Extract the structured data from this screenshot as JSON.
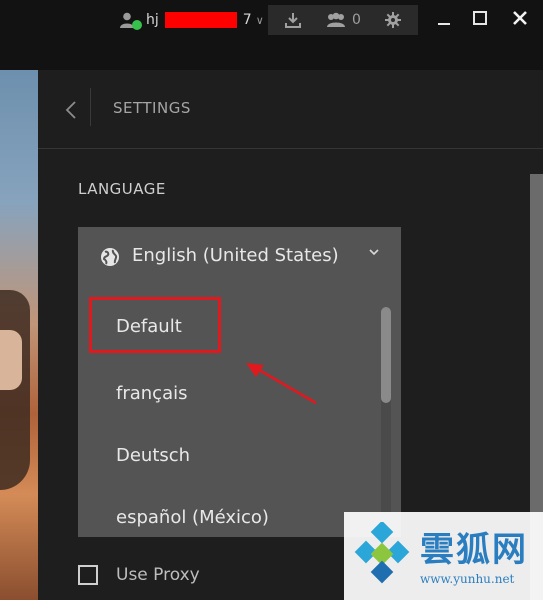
{
  "titlebar": {
    "username_prefix": "hj",
    "username_suffix": "7",
    "friends_count": "0"
  },
  "settings": {
    "header_title": "SETTINGS",
    "language_label": "LANGUAGE",
    "selected_language": "English (United States)",
    "options": [
      "Default",
      "français",
      "Deutsch",
      "español (México)"
    ],
    "use_proxy_label": "Use Proxy"
  },
  "watermark": {
    "cn_text": "雲狐网",
    "url": "www.yunhu.net"
  },
  "colors": {
    "highlight": "#e0191e",
    "online": "#37c04b"
  },
  "icons": [
    "user-icon",
    "download-icon",
    "friends-icon",
    "gear-icon",
    "minimize-icon",
    "maximize-icon",
    "close-icon",
    "back-arrow-icon",
    "globe-icon",
    "chevron-down-icon"
  ]
}
